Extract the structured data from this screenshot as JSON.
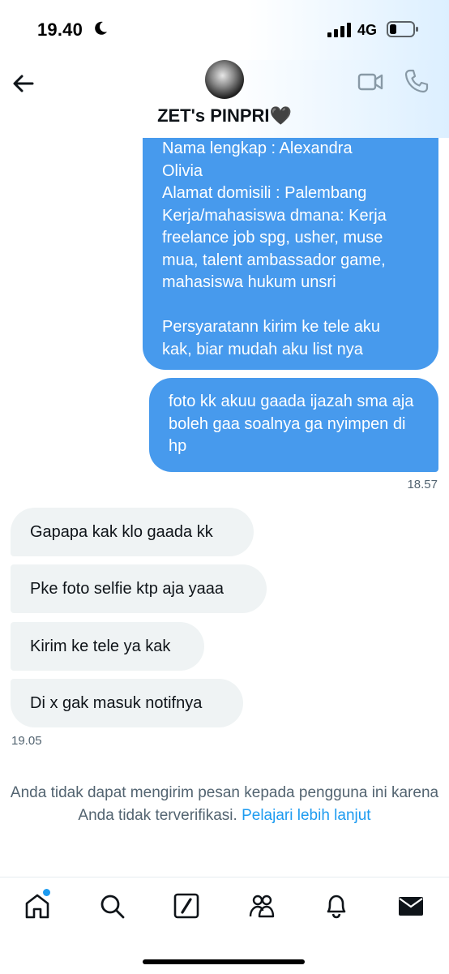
{
  "status": {
    "time": "19.40",
    "network": "4G"
  },
  "header": {
    "title": "ZET's PINPRI🖤"
  },
  "messages": {
    "outgoing_1": "Nama lengkap : Alexandra\nOlivia\nAlamat domisili : Palembang\nKerja/mahasiswa dmana: Kerja\nfreelance job spg, usher, muse\nmua, talent ambassador game,\nmahasiswa hukum unsri\n\nPersyaratann kirim ke tele aku\nkak, biar mudah aku list nya",
    "outgoing_2": "foto kk akuu gaada ijazah sma aja boleh gaa soalnya ga nyimpen di hp",
    "outgoing_time": "18.57",
    "incoming_1": "Gapapa kak klo gaada kk",
    "incoming_2": "Pke foto selfie ktp aja yaaa",
    "incoming_3": "Kirim ke tele ya kak",
    "incoming_4": "Di x gak masuk notifnya",
    "incoming_time": "19.05"
  },
  "notice": {
    "text": "Anda tidak dapat mengirim pesan kepada pengguna ini karena Anda tidak terverifikasi.",
    "link": "Pelajari lebih lanjut"
  },
  "colors": {
    "outgoing_bubble": "#479aed",
    "incoming_bubble": "#eff3f4",
    "link": "#1d9bf0",
    "muted_text": "#536471"
  },
  "icons": [
    "moon-icon",
    "signal-icon",
    "battery-icon",
    "back-arrow-icon",
    "video-camera-icon",
    "phone-icon",
    "home-icon",
    "search-icon",
    "compose-icon",
    "communities-icon",
    "bell-icon",
    "envelope-icon"
  ]
}
